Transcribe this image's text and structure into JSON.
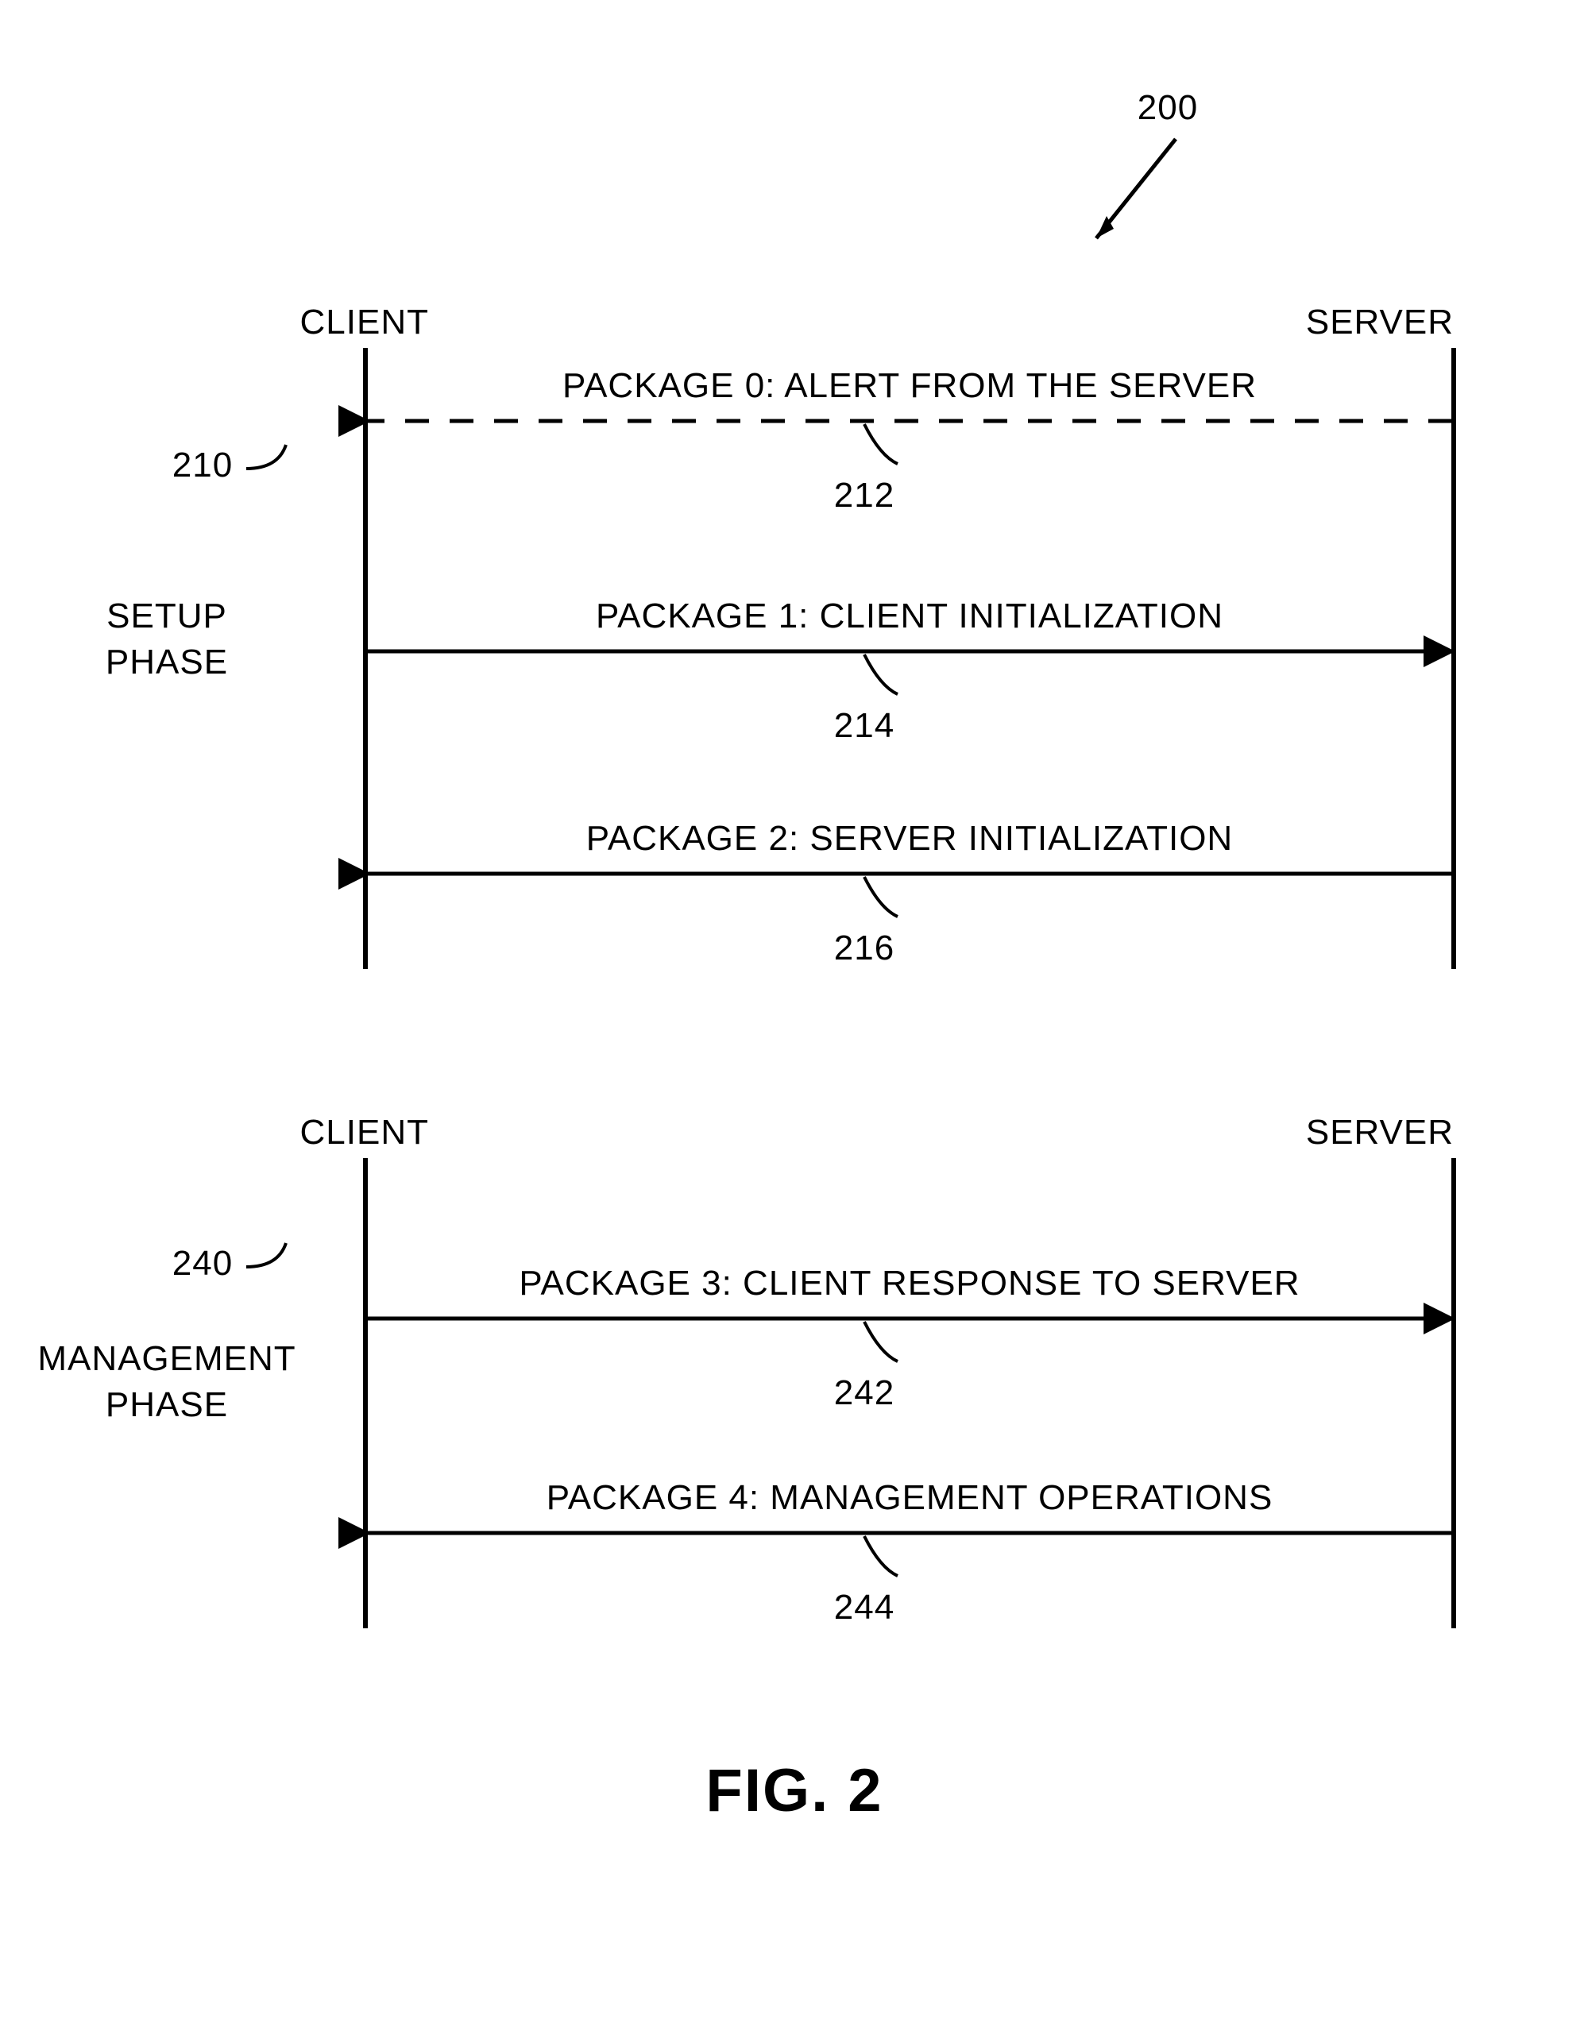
{
  "figure": {
    "overall_ref": "200",
    "title": "FIG. 2",
    "phases": [
      {
        "ref": "210",
        "name_line1": "SETUP",
        "name_line2": "PHASE",
        "client_label": "CLIENT",
        "server_label": "SERVER",
        "messages": [
          {
            "ref": "212",
            "text": "PACKAGE 0:  ALERT FROM THE SERVER",
            "direction": "left",
            "style": "dashed"
          },
          {
            "ref": "214",
            "text": "PACKAGE 1:  CLIENT INITIALIZATION",
            "direction": "right",
            "style": "solid"
          },
          {
            "ref": "216",
            "text": "PACKAGE 2:  SERVER INITIALIZATION",
            "direction": "left",
            "style": "solid"
          }
        ]
      },
      {
        "ref": "240",
        "name_line1": "MANAGEMENT",
        "name_line2": "PHASE",
        "client_label": "CLIENT",
        "server_label": "SERVER",
        "messages": [
          {
            "ref": "242",
            "text": "PACKAGE 3:  CLIENT RESPONSE TO SERVER",
            "direction": "right",
            "style": "solid"
          },
          {
            "ref": "244",
            "text": "PACKAGE 4:  MANAGEMENT OPERATIONS",
            "direction": "left",
            "style": "solid"
          }
        ]
      }
    ]
  },
  "chart_data": {
    "type": "sequence_diagram",
    "actors": [
      "CLIENT",
      "SERVER"
    ],
    "phases": [
      {
        "id": "210",
        "name": "SETUP PHASE",
        "messages": [
          {
            "id": "212",
            "from": "SERVER",
            "to": "CLIENT",
            "label": "PACKAGE 0: ALERT FROM THE SERVER",
            "optional": true
          },
          {
            "id": "214",
            "from": "CLIENT",
            "to": "SERVER",
            "label": "PACKAGE 1: CLIENT INITIALIZATION",
            "optional": false
          },
          {
            "id": "216",
            "from": "SERVER",
            "to": "CLIENT",
            "label": "PACKAGE 2: SERVER INITIALIZATION",
            "optional": false
          }
        ]
      },
      {
        "id": "240",
        "name": "MANAGEMENT PHASE",
        "messages": [
          {
            "id": "242",
            "from": "CLIENT",
            "to": "SERVER",
            "label": "PACKAGE 3: CLIENT RESPONSE TO SERVER",
            "optional": false
          },
          {
            "id": "244",
            "from": "SERVER",
            "to": "CLIENT",
            "label": "PACKAGE 4: MANAGEMENT OPERATIONS",
            "optional": false
          }
        ]
      }
    ]
  }
}
